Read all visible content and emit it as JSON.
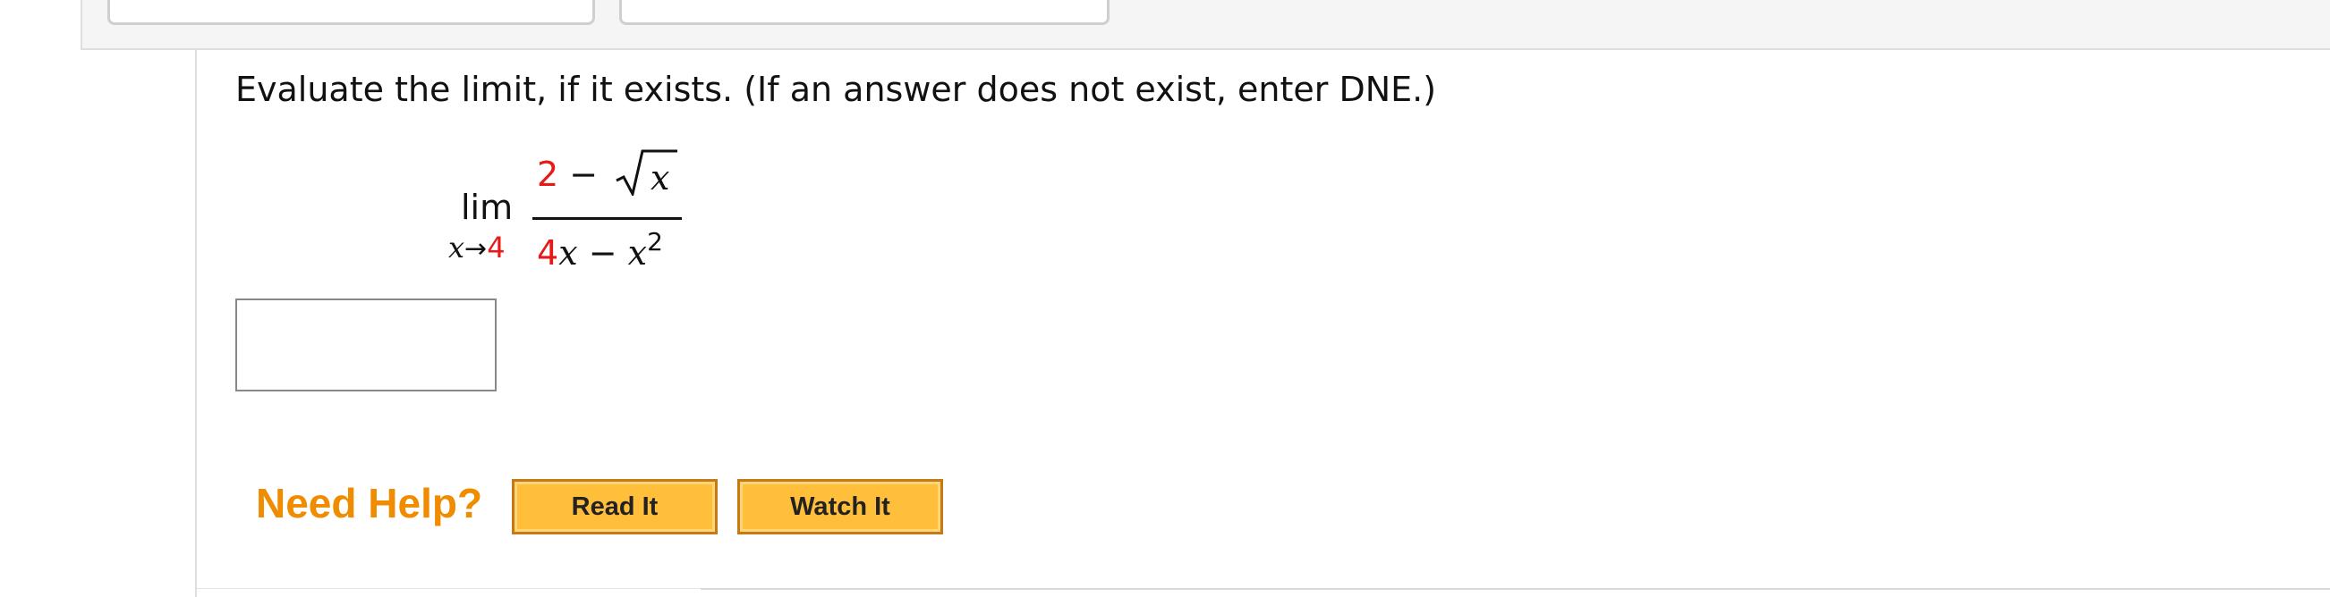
{
  "prompt": "Evaluate the limit, if it exists. (If an answer does not exist, enter DNE.)",
  "math": {
    "lim": "lim",
    "subscript_var": "x",
    "arrow": "→",
    "approach_value": "4",
    "numerator_const": "2",
    "minus": "−",
    "sqrt_var": "x",
    "denominator_coeff": "4",
    "denominator_var1": "x",
    "denominator_var2": "x",
    "exponent": "2"
  },
  "answer": {
    "value": "",
    "placeholder": ""
  },
  "help": {
    "label": "Need Help?",
    "read_it": "Read It",
    "watch_it": "Watch It"
  },
  "colors": {
    "accent_red": "#e81919",
    "help_orange": "#f08c00",
    "button_fill": "#ffbf3a",
    "button_border": "#c77915"
  }
}
